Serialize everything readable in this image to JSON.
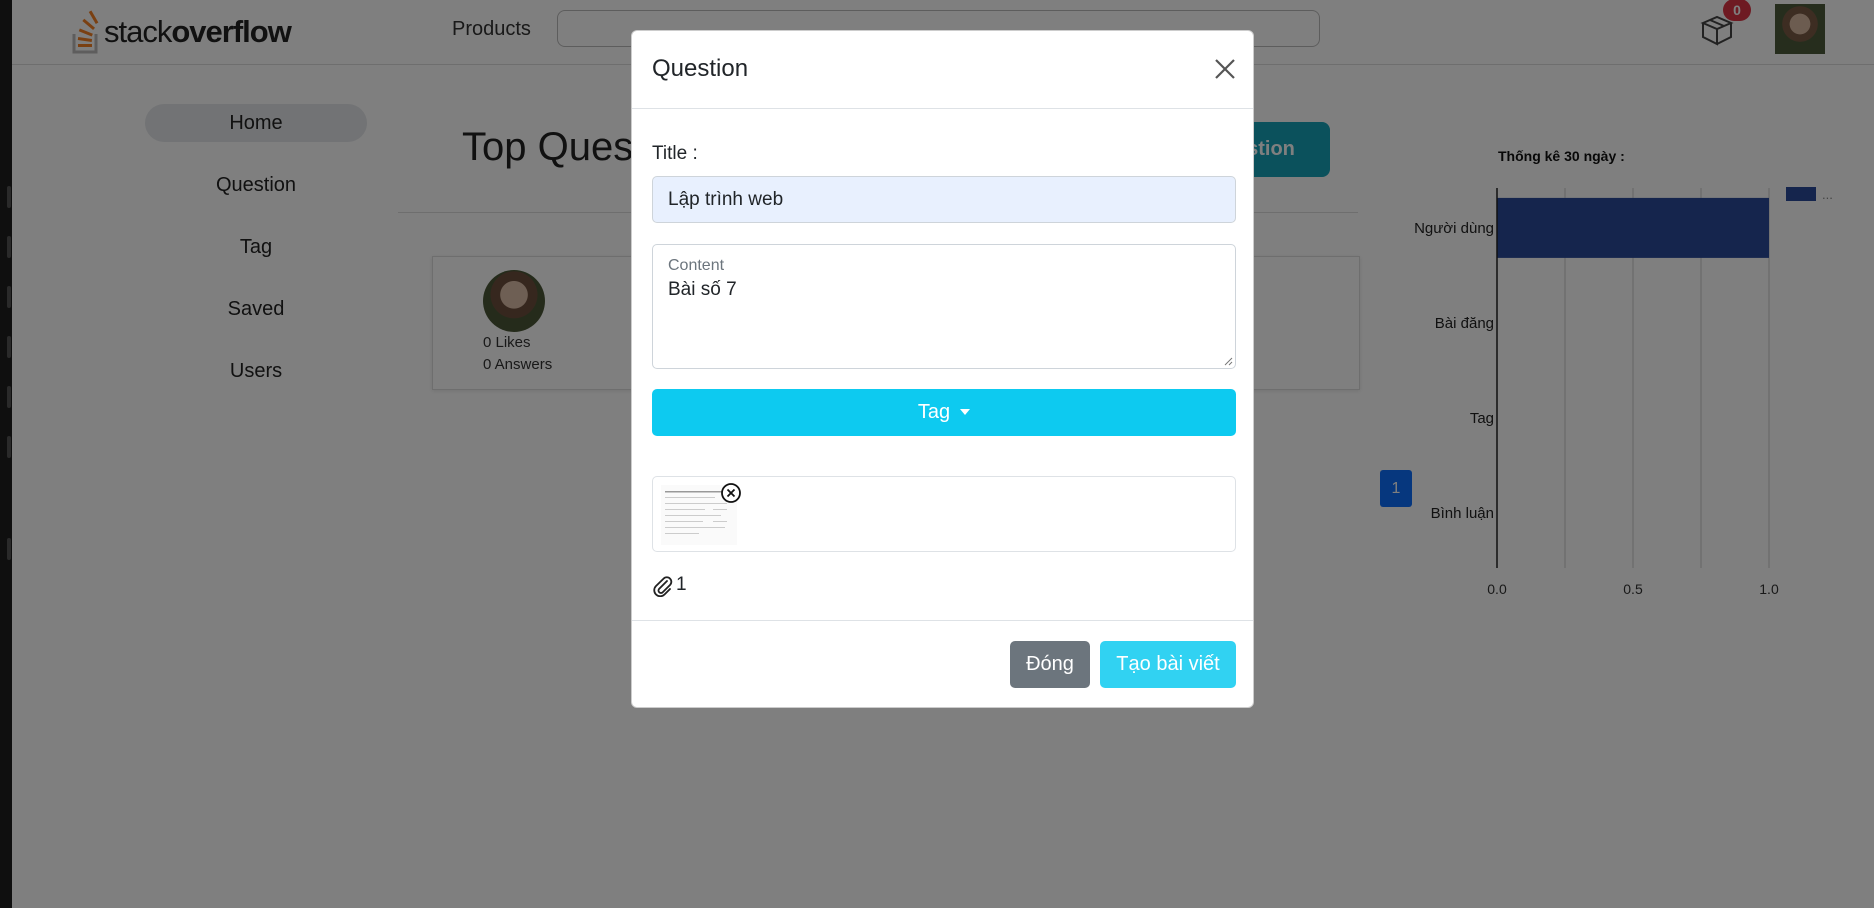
{
  "header": {
    "logo_prefix": "stack",
    "logo_suffix": "overflow",
    "products_label": "Products",
    "cart_count": "0"
  },
  "sidebar": {
    "items": [
      {
        "label": "Home",
        "active": true
      },
      {
        "label": "Question"
      },
      {
        "label": "Tag"
      },
      {
        "label": "Saved"
      },
      {
        "label": "Users"
      }
    ]
  },
  "main": {
    "title": "Top Quest",
    "ask_button_label": "estion",
    "question_card": {
      "likes": "0 Likes",
      "answers": "0 Answers"
    },
    "page_number": "1"
  },
  "stats": {
    "title": "Thống kê 30 ngày :",
    "legend_label": "..."
  },
  "chart_data": {
    "type": "bar",
    "orientation": "horizontal",
    "title": "Thống kê 30 ngày :",
    "categories": [
      "Người dùng",
      "Bài đăng",
      "Tag",
      "Bình luận"
    ],
    "values": [
      1,
      0,
      0,
      0
    ],
    "xlim": [
      0,
      1.1
    ],
    "x_ticks": [
      "0.0",
      "0.5",
      "1.0"
    ],
    "grid": true,
    "legend_position": "top-right",
    "bar_color": "#2a4a9a"
  },
  "modal": {
    "title": "Question",
    "title_label": "Title :",
    "title_value": "Lập trình web",
    "content_placeholder": "Content",
    "content_value": "Bài số 7",
    "tag_button_label": "Tag",
    "attachment_count": "1",
    "close_button_label": "Đóng",
    "create_button_label": "Tạo bài viết"
  }
}
